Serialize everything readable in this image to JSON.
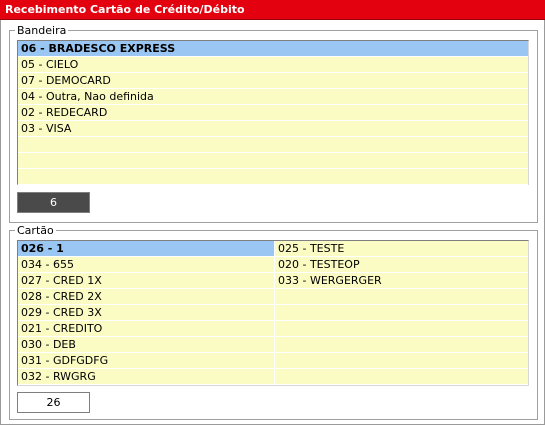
{
  "window": {
    "title": "Recebimento Cartão de Crédito/Débito"
  },
  "bandeira": {
    "legend": "Bandeira",
    "items": [
      {
        "label": "06 - BRADESCO EXPRESS",
        "selected": true
      },
      {
        "label": "05 - CIELO",
        "selected": false
      },
      {
        "label": "07 - DEMOCARD",
        "selected": false
      },
      {
        "label": "04 - Outra, Nao definida",
        "selected": false
      },
      {
        "label": "02 - REDECARD",
        "selected": false
      },
      {
        "label": "03 - VISA",
        "selected": false
      }
    ],
    "count": "6"
  },
  "cartao": {
    "legend": "Cartão",
    "left_items": [
      {
        "label": "026 - 1",
        "selected": true
      },
      {
        "label": "034 - 655",
        "selected": false
      },
      {
        "label": "027 - CRED 1X",
        "selected": false
      },
      {
        "label": "028 - CRED 2X",
        "selected": false
      },
      {
        "label": "029 - CRED 3X",
        "selected": false
      },
      {
        "label": "021 - CREDITO",
        "selected": false
      },
      {
        "label": "030 - DEB",
        "selected": false
      },
      {
        "label": "031 - GDFGDFG",
        "selected": false
      },
      {
        "label": "032 - RWGRG",
        "selected": false
      }
    ],
    "right_items": [
      {
        "label": "025 - TESTE",
        "selected": false
      },
      {
        "label": "020 - TESTEOP",
        "selected": false
      },
      {
        "label": "033 - WERGERGER",
        "selected": false
      }
    ],
    "count": "26"
  },
  "colors": {
    "titlebar": "#e3000f",
    "grid_background": "#fbfbc4",
    "selection": "#99c6f2"
  }
}
